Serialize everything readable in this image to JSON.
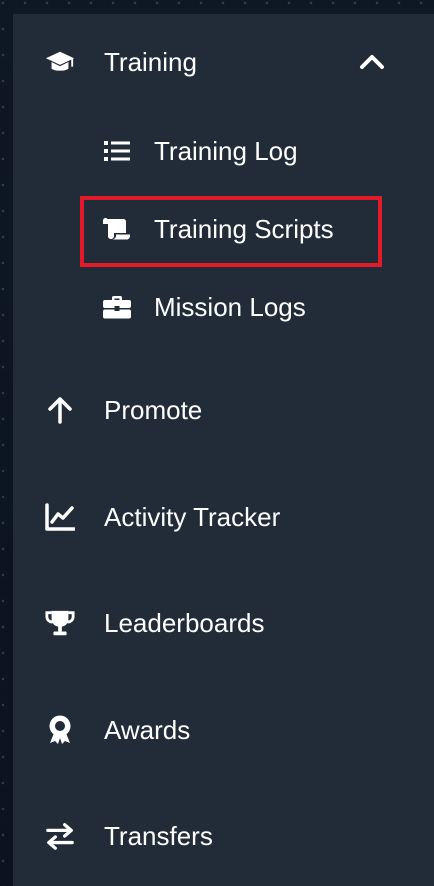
{
  "sidebar": {
    "training": {
      "label": "Training",
      "icon": "graduation-cap-icon",
      "expanded": true,
      "children": [
        {
          "label": "Training Log",
          "icon": "list-icon"
        },
        {
          "label": "Training Scripts",
          "icon": "scroll-icon",
          "highlighted": true
        },
        {
          "label": "Mission Logs",
          "icon": "briefcase-icon"
        }
      ]
    },
    "items": [
      {
        "label": "Promote",
        "icon": "arrow-up-icon"
      },
      {
        "label": "Activity Tracker",
        "icon": "line-chart-icon"
      },
      {
        "label": "Leaderboards",
        "icon": "trophy-icon"
      },
      {
        "label": "Awards",
        "icon": "award-icon"
      },
      {
        "label": "Transfers",
        "icon": "exchange-icon"
      }
    ]
  },
  "colors": {
    "panel": "#222b38",
    "text": "#ffffff",
    "highlight_border": "#e21b2a"
  }
}
